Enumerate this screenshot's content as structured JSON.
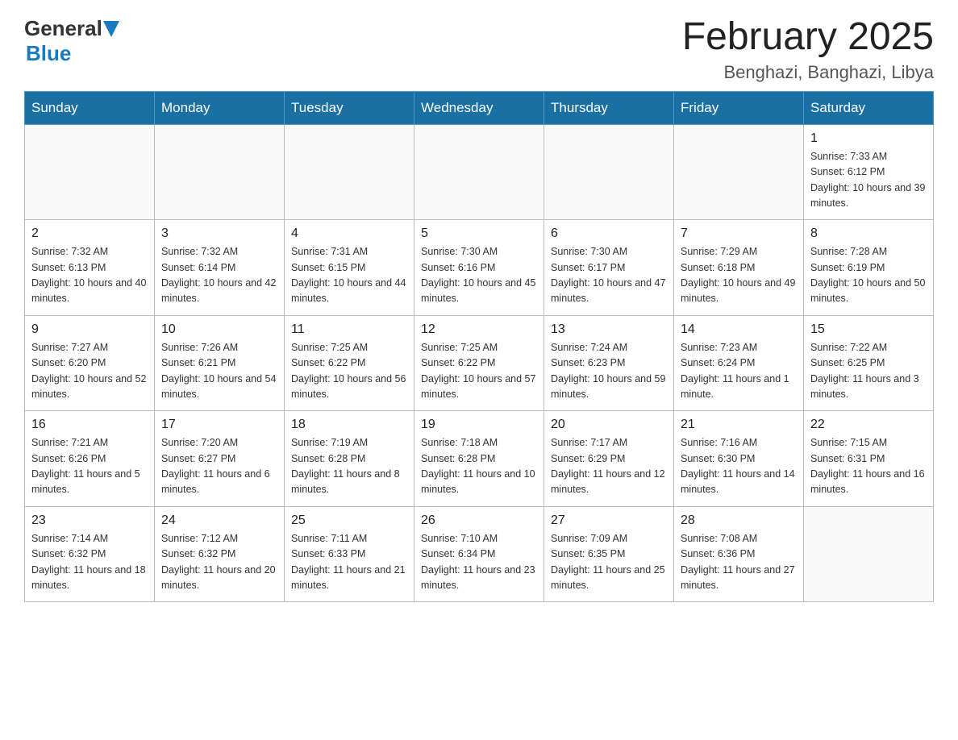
{
  "header": {
    "logo_general": "General",
    "logo_blue": "Blue",
    "title": "February 2025",
    "location": "Benghazi, Banghazi, Libya"
  },
  "days_of_week": [
    "Sunday",
    "Monday",
    "Tuesday",
    "Wednesday",
    "Thursday",
    "Friday",
    "Saturday"
  ],
  "weeks": [
    [
      {
        "day": "",
        "sunrise": "",
        "sunset": "",
        "daylight": ""
      },
      {
        "day": "",
        "sunrise": "",
        "sunset": "",
        "daylight": ""
      },
      {
        "day": "",
        "sunrise": "",
        "sunset": "",
        "daylight": ""
      },
      {
        "day": "",
        "sunrise": "",
        "sunset": "",
        "daylight": ""
      },
      {
        "day": "",
        "sunrise": "",
        "sunset": "",
        "daylight": ""
      },
      {
        "day": "",
        "sunrise": "",
        "sunset": "",
        "daylight": ""
      },
      {
        "day": "1",
        "sunrise": "Sunrise: 7:33 AM",
        "sunset": "Sunset: 6:12 PM",
        "daylight": "Daylight: 10 hours and 39 minutes."
      }
    ],
    [
      {
        "day": "2",
        "sunrise": "Sunrise: 7:32 AM",
        "sunset": "Sunset: 6:13 PM",
        "daylight": "Daylight: 10 hours and 40 minutes."
      },
      {
        "day": "3",
        "sunrise": "Sunrise: 7:32 AM",
        "sunset": "Sunset: 6:14 PM",
        "daylight": "Daylight: 10 hours and 42 minutes."
      },
      {
        "day": "4",
        "sunrise": "Sunrise: 7:31 AM",
        "sunset": "Sunset: 6:15 PM",
        "daylight": "Daylight: 10 hours and 44 minutes."
      },
      {
        "day": "5",
        "sunrise": "Sunrise: 7:30 AM",
        "sunset": "Sunset: 6:16 PM",
        "daylight": "Daylight: 10 hours and 45 minutes."
      },
      {
        "day": "6",
        "sunrise": "Sunrise: 7:30 AM",
        "sunset": "Sunset: 6:17 PM",
        "daylight": "Daylight: 10 hours and 47 minutes."
      },
      {
        "day": "7",
        "sunrise": "Sunrise: 7:29 AM",
        "sunset": "Sunset: 6:18 PM",
        "daylight": "Daylight: 10 hours and 49 minutes."
      },
      {
        "day": "8",
        "sunrise": "Sunrise: 7:28 AM",
        "sunset": "Sunset: 6:19 PM",
        "daylight": "Daylight: 10 hours and 50 minutes."
      }
    ],
    [
      {
        "day": "9",
        "sunrise": "Sunrise: 7:27 AM",
        "sunset": "Sunset: 6:20 PM",
        "daylight": "Daylight: 10 hours and 52 minutes."
      },
      {
        "day": "10",
        "sunrise": "Sunrise: 7:26 AM",
        "sunset": "Sunset: 6:21 PM",
        "daylight": "Daylight: 10 hours and 54 minutes."
      },
      {
        "day": "11",
        "sunrise": "Sunrise: 7:25 AM",
        "sunset": "Sunset: 6:22 PM",
        "daylight": "Daylight: 10 hours and 56 minutes."
      },
      {
        "day": "12",
        "sunrise": "Sunrise: 7:25 AM",
        "sunset": "Sunset: 6:22 PM",
        "daylight": "Daylight: 10 hours and 57 minutes."
      },
      {
        "day": "13",
        "sunrise": "Sunrise: 7:24 AM",
        "sunset": "Sunset: 6:23 PM",
        "daylight": "Daylight: 10 hours and 59 minutes."
      },
      {
        "day": "14",
        "sunrise": "Sunrise: 7:23 AM",
        "sunset": "Sunset: 6:24 PM",
        "daylight": "Daylight: 11 hours and 1 minute."
      },
      {
        "day": "15",
        "sunrise": "Sunrise: 7:22 AM",
        "sunset": "Sunset: 6:25 PM",
        "daylight": "Daylight: 11 hours and 3 minutes."
      }
    ],
    [
      {
        "day": "16",
        "sunrise": "Sunrise: 7:21 AM",
        "sunset": "Sunset: 6:26 PM",
        "daylight": "Daylight: 11 hours and 5 minutes."
      },
      {
        "day": "17",
        "sunrise": "Sunrise: 7:20 AM",
        "sunset": "Sunset: 6:27 PM",
        "daylight": "Daylight: 11 hours and 6 minutes."
      },
      {
        "day": "18",
        "sunrise": "Sunrise: 7:19 AM",
        "sunset": "Sunset: 6:28 PM",
        "daylight": "Daylight: 11 hours and 8 minutes."
      },
      {
        "day": "19",
        "sunrise": "Sunrise: 7:18 AM",
        "sunset": "Sunset: 6:28 PM",
        "daylight": "Daylight: 11 hours and 10 minutes."
      },
      {
        "day": "20",
        "sunrise": "Sunrise: 7:17 AM",
        "sunset": "Sunset: 6:29 PM",
        "daylight": "Daylight: 11 hours and 12 minutes."
      },
      {
        "day": "21",
        "sunrise": "Sunrise: 7:16 AM",
        "sunset": "Sunset: 6:30 PM",
        "daylight": "Daylight: 11 hours and 14 minutes."
      },
      {
        "day": "22",
        "sunrise": "Sunrise: 7:15 AM",
        "sunset": "Sunset: 6:31 PM",
        "daylight": "Daylight: 11 hours and 16 minutes."
      }
    ],
    [
      {
        "day": "23",
        "sunrise": "Sunrise: 7:14 AM",
        "sunset": "Sunset: 6:32 PM",
        "daylight": "Daylight: 11 hours and 18 minutes."
      },
      {
        "day": "24",
        "sunrise": "Sunrise: 7:12 AM",
        "sunset": "Sunset: 6:32 PM",
        "daylight": "Daylight: 11 hours and 20 minutes."
      },
      {
        "day": "25",
        "sunrise": "Sunrise: 7:11 AM",
        "sunset": "Sunset: 6:33 PM",
        "daylight": "Daylight: 11 hours and 21 minutes."
      },
      {
        "day": "26",
        "sunrise": "Sunrise: 7:10 AM",
        "sunset": "Sunset: 6:34 PM",
        "daylight": "Daylight: 11 hours and 23 minutes."
      },
      {
        "day": "27",
        "sunrise": "Sunrise: 7:09 AM",
        "sunset": "Sunset: 6:35 PM",
        "daylight": "Daylight: 11 hours and 25 minutes."
      },
      {
        "day": "28",
        "sunrise": "Sunrise: 7:08 AM",
        "sunset": "Sunset: 6:36 PM",
        "daylight": "Daylight: 11 hours and 27 minutes."
      },
      {
        "day": "",
        "sunrise": "",
        "sunset": "",
        "daylight": ""
      }
    ]
  ]
}
